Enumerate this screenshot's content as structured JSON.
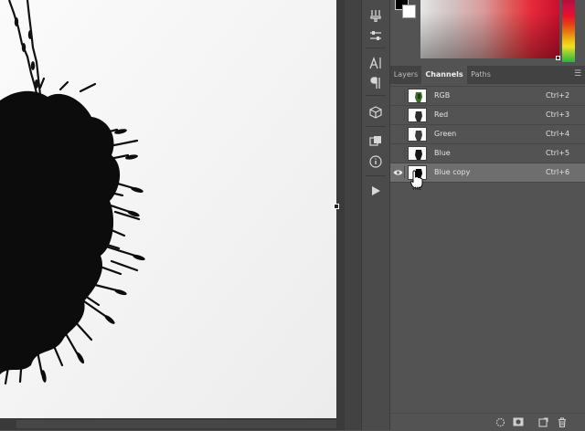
{
  "panel": {
    "tabs": [
      {
        "label": "Layers",
        "active": false
      },
      {
        "label": "Channels",
        "active": true
      },
      {
        "label": "Paths",
        "active": false
      }
    ],
    "channels": [
      {
        "name": "RGB",
        "shortcut": "Ctrl+2",
        "visible": false,
        "selected": false,
        "thumb": "rgb"
      },
      {
        "name": "Red",
        "shortcut": "Ctrl+3",
        "visible": false,
        "selected": false,
        "thumb": "gray"
      },
      {
        "name": "Green",
        "shortcut": "Ctrl+4",
        "visible": false,
        "selected": false,
        "thumb": "gray"
      },
      {
        "name": "Blue",
        "shortcut": "Ctrl+5",
        "visible": false,
        "selected": false,
        "thumb": "gray"
      },
      {
        "name": "Blue copy",
        "shortcut": "Ctrl+6",
        "visible": true,
        "selected": true,
        "thumb": "mask"
      }
    ],
    "footer_icons": [
      "load-selection-icon",
      "save-selection-icon",
      "new-channel-icon",
      "delete-channel-icon"
    ]
  },
  "icon_strip": [
    "brush-settings-icon",
    "adjustments-icon",
    "character-icon",
    "paragraph-icon",
    "3d-icon",
    "info-panel-icon",
    "properties-icon",
    "play-action-icon"
  ],
  "colors": {
    "foreground": "#000000",
    "background": "#ffffff",
    "panel": "#535353",
    "selected_row": "#6e6e6e"
  }
}
